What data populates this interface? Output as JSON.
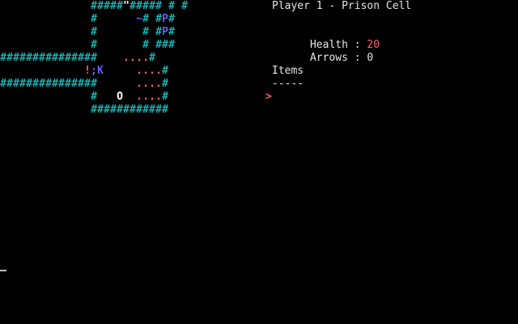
{
  "palette": {
    "wall": "#18b2b2",
    "floor": "#ff5f5f",
    "player": "#ffffff",
    "monster": "#5f5fff",
    "potion": "#ff5f5f",
    "text": "#e6e6e6",
    "health_value": "#ff5f5f",
    "prompt": "#ff5f5f"
  },
  "map": {
    "rows": [
      "              #####\"##### # #",
      "              #      ~# #P#",
      "              #       # #P#",
      "              #       # ###",
      "###############    ....#",
      "             !;K     ....#",
      "###############      ....#",
      "              #   @  ....#",
      "              ############"
    ]
  },
  "status": {
    "title": "Player 1 - Prison Cell",
    "health_label": "Health : ",
    "health_value": "20",
    "arrows_label": "Arrows : ",
    "arrows_value": "0",
    "items_header": "Items",
    "items_rule": "-----",
    "prompt_symbol": ">"
  }
}
